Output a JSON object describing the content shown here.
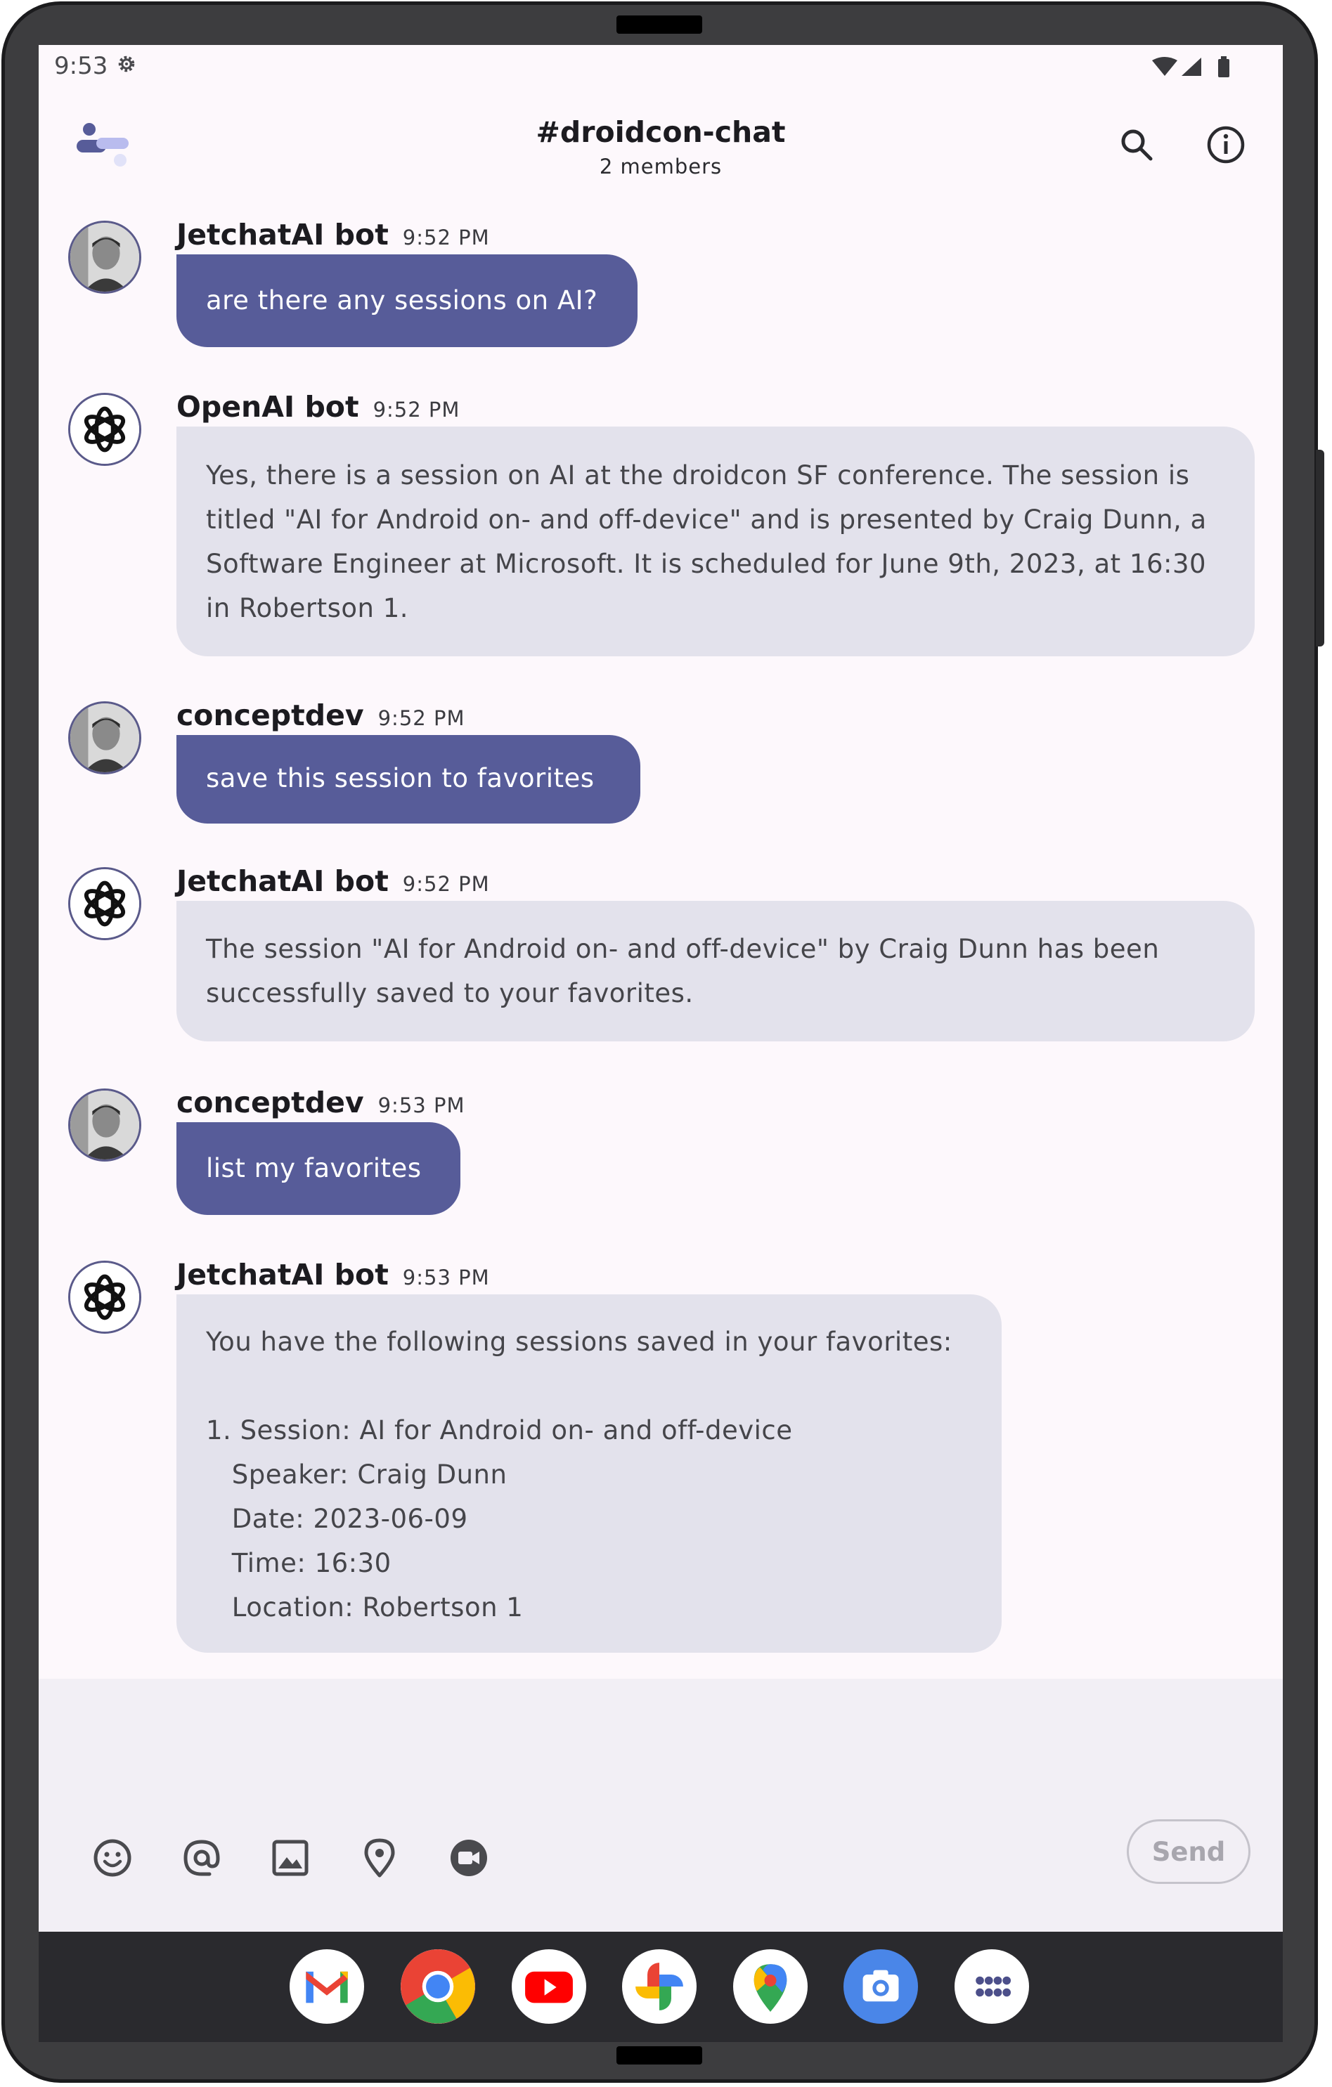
{
  "status_bar": {
    "time": "9:53"
  },
  "header": {
    "channel": "#droidcon-chat",
    "members": "2 members"
  },
  "messages": [
    {
      "author": "JetchatAI bot",
      "time": "9:52 PM",
      "text": "are there any sessions on AI?"
    },
    {
      "author": "OpenAI bot",
      "time": "9:52 PM",
      "text": "Yes, there is a session on AI at the droidcon SF conference. The session is\ntitled \"AI for Android on- and off-device\" and is presented by Craig Dunn, a\nSoftware Engineer at Microsoft. It is scheduled for June 9th, 2023, at 16:30\nin Robertson 1."
    },
    {
      "author": "conceptdev",
      "time": "9:52 PM",
      "text": "save this session to favorites"
    },
    {
      "author": "JetchatAI bot",
      "time": "9:52 PM",
      "text": "The session \"AI for Android on- and off-device\" by Craig Dunn has been\nsuccessfully saved to your favorites."
    },
    {
      "author": "conceptdev",
      "time": "9:53 PM",
      "text": "list my favorites"
    },
    {
      "author": "JetchatAI bot",
      "time": "9:53 PM",
      "text": "You have the following sessions saved in your favorites:\n\n1. Session: AI for Android on- and off-device\n   Speaker: Craig Dunn\n   Date: 2023-06-09\n   Time: 16:30\n   Location: Robertson 1"
    }
  ],
  "composer": {
    "send_label": "Send"
  },
  "colors": {
    "accent": "#575c99",
    "bot_bubble": "#e3e2ec",
    "background": "#fdf8fc",
    "dock": "#2a2a2e"
  },
  "icons": {
    "toolbar": [
      "emoji-icon",
      "at-sign-icon",
      "image-icon",
      "location-pin-icon",
      "video-call-icon"
    ],
    "dock": [
      "gmail-icon",
      "chrome-icon",
      "youtube-icon",
      "photos-icon",
      "maps-icon",
      "camera-icon",
      "app-drawer-icon"
    ]
  }
}
